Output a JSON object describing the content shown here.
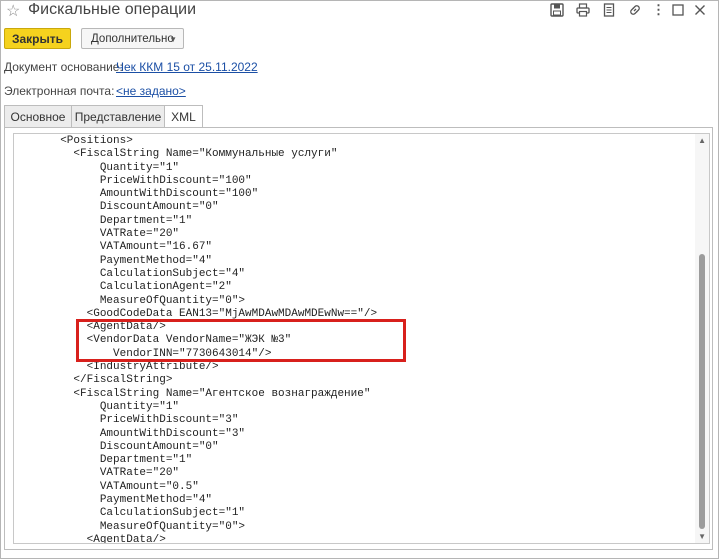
{
  "window": {
    "title": "Фискальные операции",
    "icons": [
      "star-icon",
      "save-icon",
      "print-icon",
      "document-icon",
      "link-icon",
      "more-icon",
      "maximize-icon",
      "close-icon"
    ]
  },
  "toolbar": {
    "close_label": "Закрыть",
    "more_label": "Дополнительно"
  },
  "fields": {
    "base_doc_label": "Документ основание:",
    "base_doc_value": "Чек ККМ 15 от 25.11.2022",
    "email_label": "Электронная почта:",
    "email_value": "<не задано>"
  },
  "tabs": [
    {
      "label": "Основное"
    },
    {
      "label": "Представление"
    },
    {
      "label": "XML"
    }
  ],
  "colors": {
    "accent_button": "#f5d21e",
    "link": "#1b4fa5",
    "highlight": "#d8201c"
  },
  "xml_lines": [
    "       <Positions>",
    "         <FiscalString Name=\"Коммунальные услуги\"",
    "             Quantity=\"1\"",
    "             PriceWithDiscount=\"100\"",
    "             AmountWithDiscount=\"100\"",
    "             DiscountAmount=\"0\"",
    "             Department=\"1\"",
    "             VATRate=\"20\"",
    "             VATAmount=\"16.67\"",
    "             PaymentMethod=\"4\"",
    "             CalculationSubject=\"4\"",
    "             CalculationAgent=\"2\"",
    "             MeasureOfQuantity=\"0\">",
    "           <GoodCodeData EAN13=\"MjAwMDAwMDAwMDEwNw==\"/>",
    "           <AgentData/>",
    "           <VendorData VendorName=\"ЖЭК №3\"",
    "               VendorINN=\"7730643014\"/>",
    "           <IndustryAttribute/>",
    "         </FiscalString>",
    "         <FiscalString Name=\"Агентское вознаграждение\"",
    "             Quantity=\"1\"",
    "             PriceWithDiscount=\"3\"",
    "             AmountWithDiscount=\"3\"",
    "             DiscountAmount=\"0\"",
    "             Department=\"1\"",
    "             VATRate=\"20\"",
    "             VATAmount=\"0.5\"",
    "             PaymentMethod=\"4\"",
    "             CalculationSubject=\"1\"",
    "             MeasureOfQuantity=\"0\">",
    "           <AgentData/>"
  ]
}
